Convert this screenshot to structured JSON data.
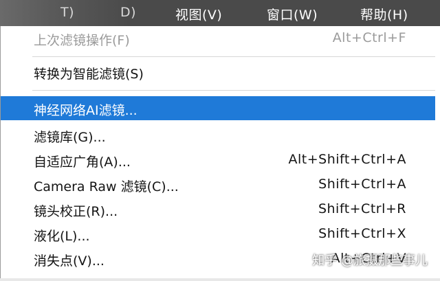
{
  "menubar": {
    "items": [
      {
        "label": "T)"
      },
      {
        "label": "D)"
      },
      {
        "label": "视图(V)"
      },
      {
        "label": "窗口(W)"
      },
      {
        "label": "帮助(H)"
      }
    ]
  },
  "filter_menu": {
    "items": [
      {
        "label": "上次滤镜操作(F)",
        "shortcut": "Alt+Ctrl+F",
        "state": "disabled"
      },
      {
        "label": "转换为智能滤镜(S)",
        "shortcut": "",
        "state": "normal"
      },
      {
        "label": "神经网络AI滤镜...",
        "shortcut": "",
        "state": "highlighted"
      },
      {
        "label": "滤镜库(G)...",
        "shortcut": "",
        "state": "normal"
      },
      {
        "label": "自适应广角(A)...",
        "shortcut": "Alt+Shift+Ctrl+A",
        "state": "normal"
      },
      {
        "label": "Camera Raw 滤镜(C)...",
        "shortcut": "Shift+Ctrl+A",
        "state": "normal"
      },
      {
        "label": "镜头校正(R)...",
        "shortcut": "Shift+Ctrl+R",
        "state": "normal"
      },
      {
        "label": "液化(L)...",
        "shortcut": "Shift+Ctrl+X",
        "state": "normal"
      },
      {
        "label": "消失点(V)...",
        "shortcut": "Alt+Ctrl+V",
        "state": "normal"
      }
    ]
  },
  "watermark": {
    "text": "知乎 @旅摄那些事儿"
  },
  "colors": {
    "menubar_bg": "#4a4a4a",
    "highlight": "#1f7ad8",
    "disabled_text": "#9a9a9a"
  }
}
